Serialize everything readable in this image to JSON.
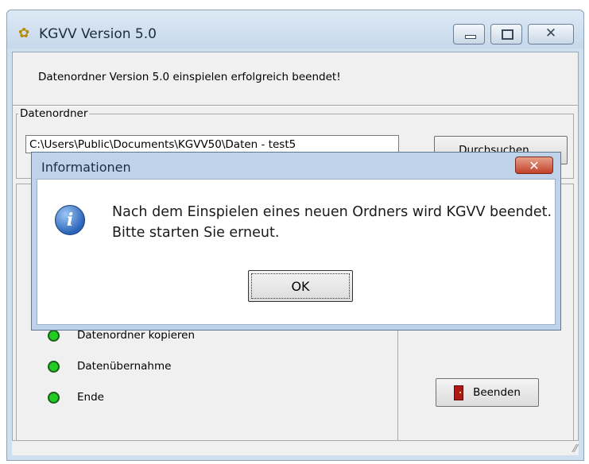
{
  "window": {
    "title": "KGVV Version 5.0",
    "app_icon": "sunflower-icon",
    "controls": {
      "minimize_icon": "minimize-icon",
      "maximize_icon": "maximize-icon",
      "close_icon": "close-icon",
      "close_glyph": "✕"
    }
  },
  "main": {
    "status_message": "Datenordner Version 5.0 einspielen erfolgreich beendet!",
    "group_label": "Datenordner",
    "path_value": "C:\\Users\\Public\\Documents\\KGVV50\\Daten - test5",
    "browse_label": "Durchsuchen ...",
    "steps": [
      {
        "label": "Datenordner kopieren",
        "status_color": "#22cc22"
      },
      {
        "label": "Datenübernahme",
        "status_color": "#22cc22"
      },
      {
        "label": "Ende",
        "status_color": "#22cc22"
      }
    ],
    "exit_label": "Beenden",
    "exit_icon": "door-exit-icon"
  },
  "dialog": {
    "title": "Informationen",
    "close_glyph": "✕",
    "icon": "info-icon",
    "icon_glyph": "i",
    "message_line1": "Nach dem Einspielen eines neuen Ordners wird KGVV beendet.",
    "message_line2": "Bitte starten Sie erneut.",
    "ok_label": "OK"
  }
}
